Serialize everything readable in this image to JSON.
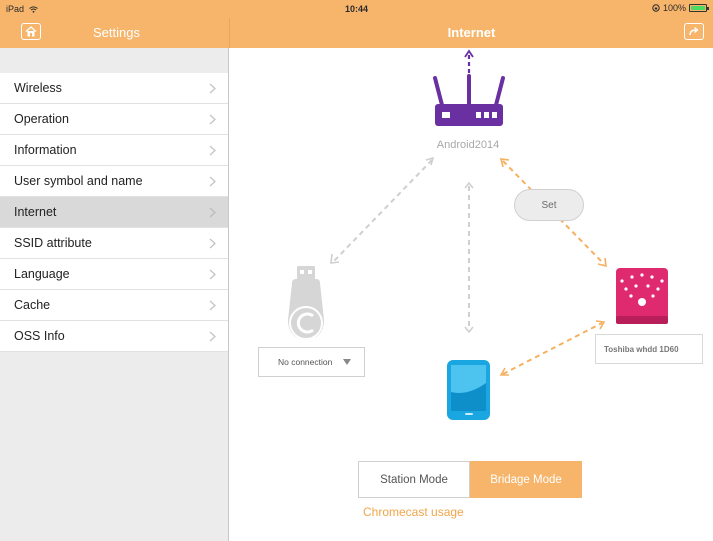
{
  "status_bar": {
    "device": "iPad",
    "time": "10:44",
    "battery": "100%"
  },
  "nav": {
    "left_title": "Settings",
    "right_title": "Internet",
    "home_icon": "home-icon",
    "share_icon": "share-icon"
  },
  "sidebar": {
    "items": [
      {
        "label": "Wireless"
      },
      {
        "label": "Operation"
      },
      {
        "label": "Information"
      },
      {
        "label": "User symbol and name"
      },
      {
        "label": "Internet",
        "selected": true
      },
      {
        "label": "SSID attribute"
      },
      {
        "label": "Language"
      },
      {
        "label": "Cache"
      },
      {
        "label": "OSS Info"
      }
    ]
  },
  "diagram": {
    "router_name": "Android2014",
    "set_label": "Set",
    "chromecast_status": "No connection",
    "hdd_name": "Toshiba whdd 1D60",
    "colors": {
      "router": "#6a2fa0",
      "hdd": "#e02a70",
      "phone": "#1aa6e0",
      "link_active": "#f5b060",
      "link_inactive": "#cfcfcf"
    }
  },
  "mode": {
    "station_label": "Station Mode",
    "bridge_label": "Bridage Mode",
    "selected": "bridge"
  },
  "chromecast_link": "Chromecast usage"
}
